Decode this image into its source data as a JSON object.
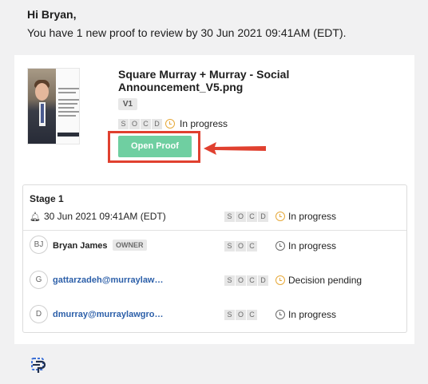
{
  "greeting": "Hi Bryan,",
  "intro": "You have 1 new proof to review by 30 Jun 2021 09:41AM (EDT).",
  "proof": {
    "title": "Square Murray + Murray - Social Announcement_V5.png",
    "version": "V1",
    "status": "In progress",
    "socd": [
      "S",
      "O",
      "C",
      "D"
    ],
    "open_button": "Open Proof"
  },
  "stage": {
    "name": "Stage 1",
    "date": "30 Jun 2021 09:41AM (EDT)",
    "socd": [
      "S",
      "O",
      "C",
      "D"
    ],
    "status": "In progress",
    "reviewers": [
      {
        "initials": "BJ",
        "name": "Bryan James",
        "badge": "OWNER",
        "socd": [
          "S",
          "O",
          "C"
        ],
        "status": "In progress"
      },
      {
        "initials": "G",
        "name": "gattarzadeh@murraylaw…",
        "socd": [
          "S",
          "O",
          "C",
          "D"
        ],
        "status": "Decision pending"
      },
      {
        "initials": "D",
        "name": "dmurray@murraylawgro…",
        "socd": [
          "S",
          "O",
          "C"
        ],
        "status": "In progress"
      }
    ]
  },
  "colors": {
    "open_button": "#6fcfa1",
    "highlight": "#e0402f",
    "link": "#2c5fa9",
    "pending_clock": "#e6a93a"
  }
}
